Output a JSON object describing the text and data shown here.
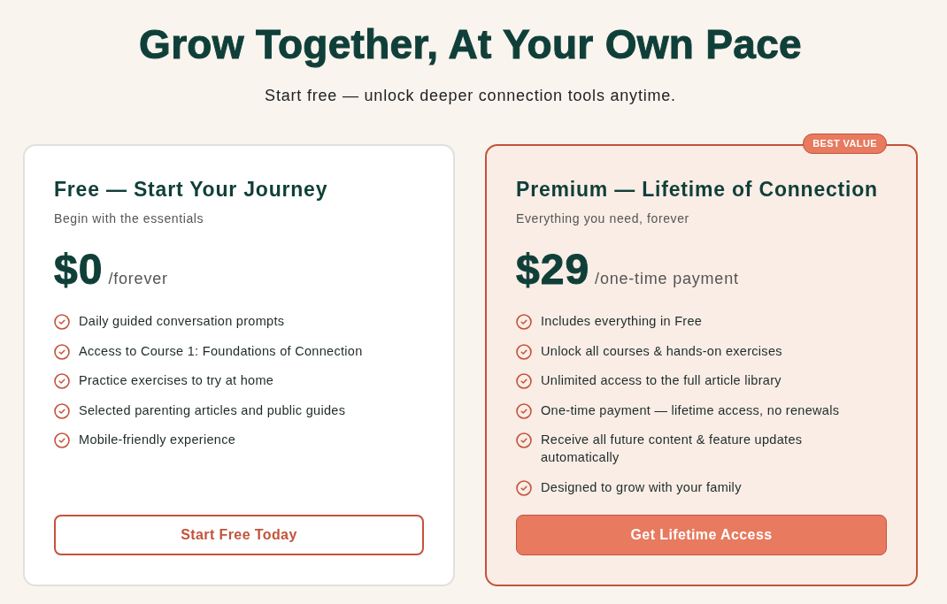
{
  "header": {
    "title": "Grow Together, At Your Own Pace",
    "subtitle": "Start free — unlock deeper connection tools anytime."
  },
  "plans": [
    {
      "featured": false,
      "title": "Free — Start Your Journey",
      "subtitle": "Begin with the essentials",
      "price": "$0",
      "period": "/forever",
      "features": [
        "Daily guided conversation prompts",
        "Access to Course 1: Foundations of Connection",
        "Practice exercises to try at home",
        "Selected parenting articles and public guides",
        "Mobile-friendly experience"
      ],
      "button": {
        "label": "Start Free Today",
        "kind": "outline"
      }
    },
    {
      "featured": true,
      "badge": "BEST VALUE",
      "title": "Premium — Lifetime of Connection",
      "subtitle": "Everything you need, forever",
      "price": "$29",
      "period": "/one-time payment",
      "features": [
        "Includes everything in Free",
        "Unlock all courses & hands-on exercises",
        "Unlimited access to the full article library",
        "One-time payment — lifetime access, no renewals",
        "Receive all future content & feature updates automatically",
        "Designed to grow with your family"
      ],
      "button": {
        "label": "Get Lifetime Access",
        "kind": "filled"
      }
    }
  ]
}
